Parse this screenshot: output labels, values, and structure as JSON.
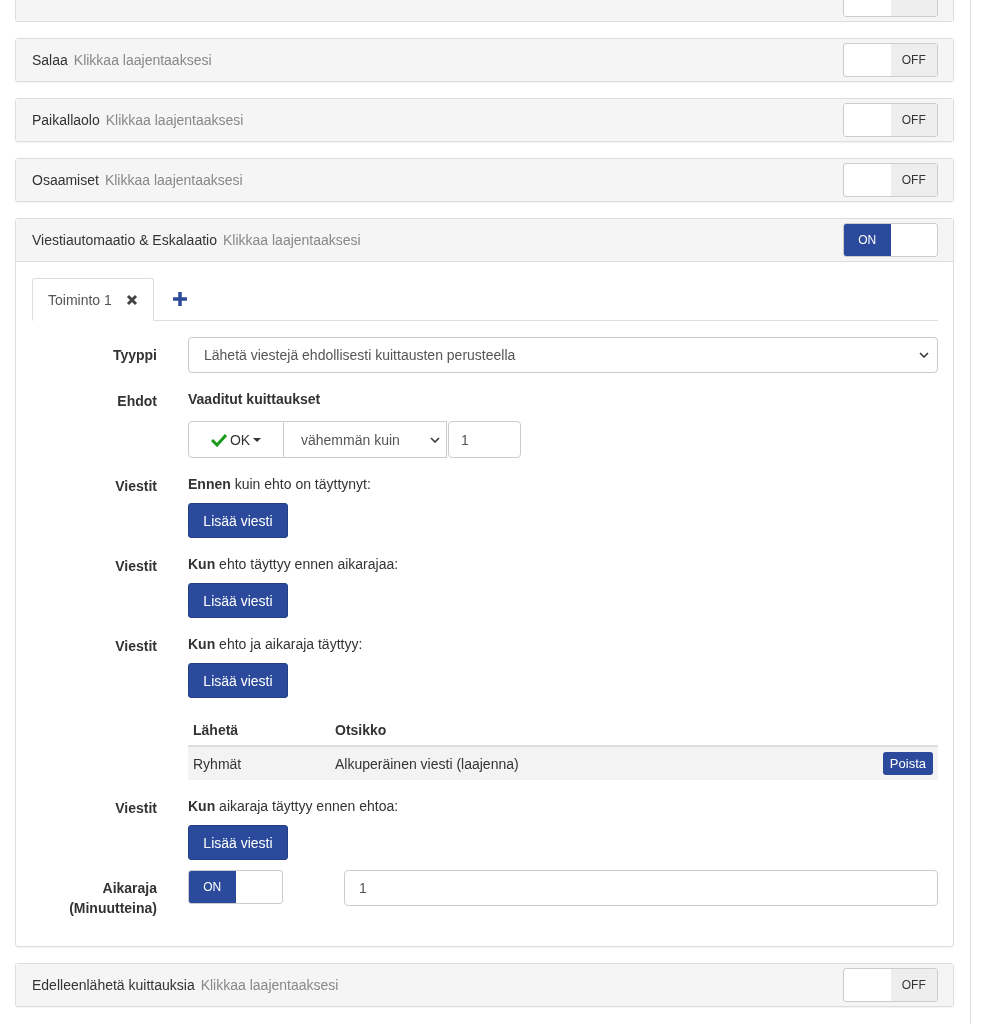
{
  "panels": [
    {
      "kind": "cut",
      "toggle": {
        "on": false
      }
    },
    {
      "kind": "collapsed",
      "title": "Salaa",
      "hint": "Klikkaa laajentaaksesi",
      "toggle": {
        "on": false,
        "label": "OFF"
      }
    },
    {
      "kind": "collapsed",
      "title": "Paikallaolo",
      "hint": "Klikkaa laajentaaksesi",
      "toggle": {
        "on": false,
        "label": "OFF"
      }
    },
    {
      "kind": "collapsed",
      "title": "Osaamiset",
      "hint": "Klikkaa laajentaaksesi",
      "toggle": {
        "on": false,
        "label": "OFF"
      }
    },
    {
      "kind": "expanded",
      "title": "Viestiautomaatio & Eskalaatio",
      "hint": "Klikkaa laajentaaksesi",
      "toggle": {
        "on": true,
        "label": "ON"
      },
      "tabs": [
        {
          "label": "Toiminto 1",
          "selected": true
        }
      ],
      "rows": [
        {
          "kind": "select",
          "label": "Tyyppi",
          "value": "Lähetä viestejä ehdollisesti kuittausten perusteella"
        },
        {
          "kind": "conditions",
          "label": "Ehdot",
          "heading": "Vaaditut kuittaukset",
          "ack_button": "OK",
          "comparison": "vähemmän kuin",
          "count": "1"
        },
        {
          "kind": "messages",
          "label": "Viestit",
          "text": "**Ennen** kuin ehto on täyttynyt:",
          "button": "Lisää viesti"
        },
        {
          "kind": "messages",
          "label": "Viestit",
          "text": "**Kun** ehto täyttyy ennen aikarajaa:",
          "button": "Lisää viesti"
        },
        {
          "kind": "messages",
          "label": "Viestit",
          "text": "**Kun** ehto ja aikaraja täyttyy:",
          "button": "Lisää viesti",
          "table": {
            "columns": [
              "Lähetä",
              "Otsikko"
            ],
            "rows": [
              {
                "cells": [
                  "Ryhmät",
                  "Alkuperäinen viesti (laajenna)"
                ],
                "action": "Poista"
              }
            ]
          }
        },
        {
          "kind": "messages",
          "label": "Viestit",
          "text": "**Kun** aikaraja täyttyy ennen ehtoa:",
          "button": "Lisää viesti"
        },
        {
          "kind": "timeout",
          "label": "Aikaraja (Minuutteina)",
          "toggle": {
            "on": true,
            "label": "ON"
          },
          "value": "1"
        }
      ]
    },
    {
      "kind": "collapsed",
      "title": "Edelleenlähetä kuittauksia",
      "hint": "Klikkaa laajentaaksesi",
      "toggle": {
        "on": false,
        "label": "OFF"
      }
    }
  ]
}
